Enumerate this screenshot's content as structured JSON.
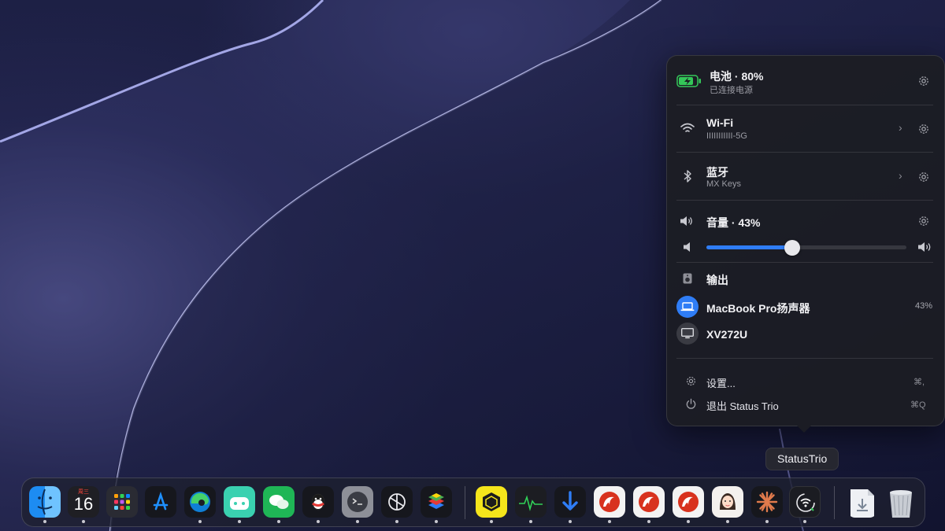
{
  "battery": {
    "title": "电池 · 80%",
    "subtitle": "已连接电源",
    "level": 0.8
  },
  "wifi": {
    "title": "Wi-Fi",
    "subtitle": "IIIIIIIIIII-5G"
  },
  "bluetooth": {
    "title": "蓝牙",
    "subtitle": "MX Keys"
  },
  "volume": {
    "title": "音量 · 43%",
    "level": 0.43
  },
  "output": {
    "title": "输出",
    "devices": [
      {
        "name": "MacBook Pro扬声器",
        "value": "43%"
      },
      {
        "name": "XV272U",
        "value": ""
      }
    ]
  },
  "menu": {
    "settings_label": "设置...",
    "settings_shortcut": "⌘,",
    "quit_label": "退出 Status Trio",
    "quit_shortcut": "⌘Q"
  },
  "tooltip": "StatusTrio",
  "calendar": {
    "weekday": "周三",
    "day": "16"
  },
  "colors": {
    "accent": "#2f7df6",
    "battery": "#34c759",
    "popover_bg": "#1c1d24"
  },
  "dock": {
    "apps": [
      "finder-icon",
      "calendar-icon",
      "launchpad-icon",
      "app-store-icon",
      "edge-icon",
      "game-launcher-icon",
      "wechat-icon",
      "qq-icon",
      "terminal-icon",
      "chatgpt-icon",
      "bluestacks-icon",
      "yellow-cube-app-icon",
      "activity-monitor-icon",
      "download-arrow-icon",
      "red-swirl-app-1-icon",
      "red-swirl-app-2-icon",
      "red-swirl-app-3-icon",
      "avatar-app-icon",
      "claude-icon",
      "statustrio-icon",
      "downloads-folder-icon",
      "trash-icon"
    ]
  }
}
